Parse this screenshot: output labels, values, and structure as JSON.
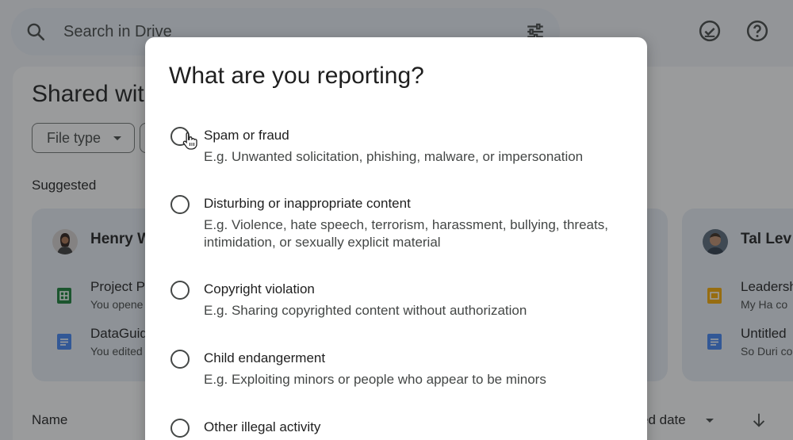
{
  "search": {
    "placeholder": "Search in Drive"
  },
  "page": {
    "title": "Shared wit"
  },
  "filters": {
    "file_type": "File type"
  },
  "suggested": {
    "label": "Suggested",
    "cards": [
      {
        "person": "Henry W",
        "files": [
          {
            "title": "Project P",
            "sub": "You opene",
            "type": "sheets"
          },
          {
            "title": "DataGuid",
            "sub": "You edited",
            "type": "docs"
          }
        ]
      },
      {
        "person": "Tal Lev",
        "files": [
          {
            "title": "Leadersh",
            "sub": "My Ha co",
            "type": "slides"
          },
          {
            "title": "Untitled",
            "sub": "So Duri co",
            "type": "docs"
          }
        ]
      }
    ]
  },
  "list_header": {
    "name": "Name",
    "date": "ed date"
  },
  "dialog": {
    "title": "What are you reporting?",
    "options": [
      {
        "label": "Spam or fraud",
        "desc": "E.g. Unwanted solicitation, phishing, malware, or impersonation"
      },
      {
        "label": "Disturbing or inappropriate content",
        "desc": "E.g. Violence, hate speech, terrorism, harassment, bullying, threats, intimidation, or sexually explicit material"
      },
      {
        "label": "Copyright violation",
        "desc": "E.g. Sharing copyrighted content without authorization"
      },
      {
        "label": "Child endangerment",
        "desc": "E.g. Exploiting minors or people who appear to be minors"
      },
      {
        "label": "Other illegal activity",
        "desc": ""
      }
    ]
  },
  "colors": {
    "sheets": "#188038",
    "docs": "#4285f4",
    "slides": "#f9ab00"
  }
}
